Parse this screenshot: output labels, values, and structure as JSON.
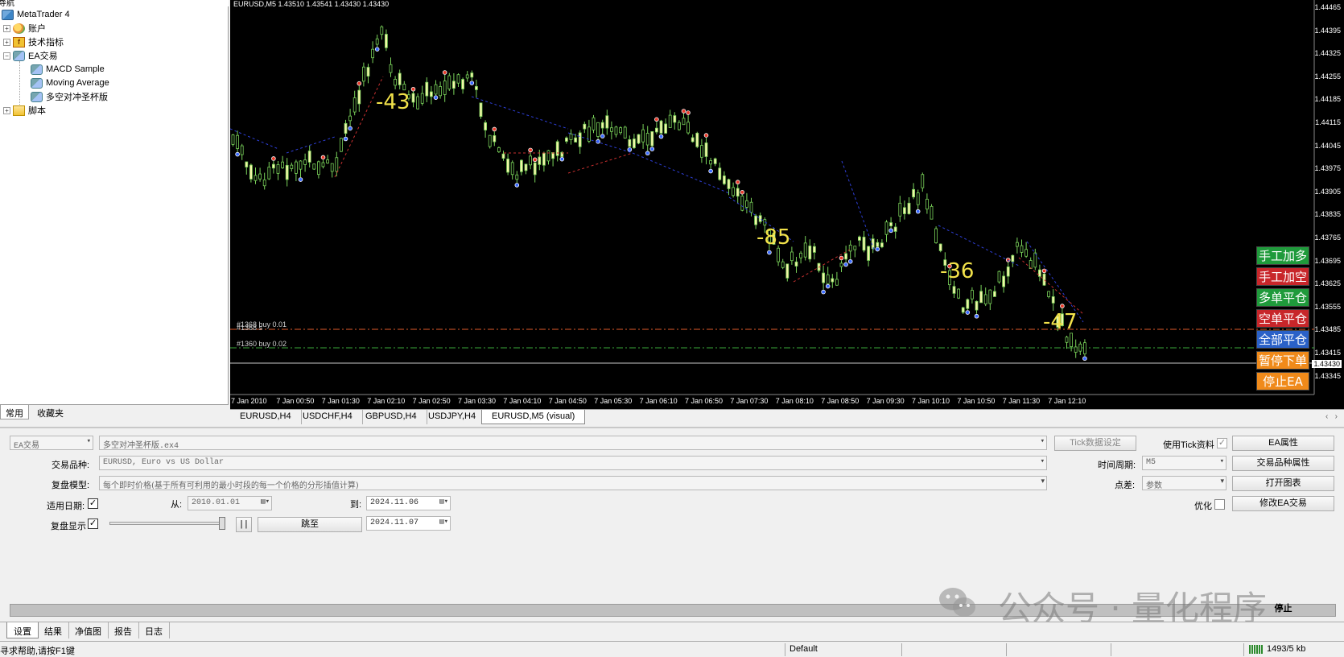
{
  "navigator": {
    "title": "导航",
    "tree": {
      "root": "MetaTrader 4",
      "accounts": "账户",
      "indicators": "技术指标",
      "experts": "EA交易",
      "expert_items": [
        "MACD Sample",
        "Moving Average",
        "多空对冲圣杯版"
      ],
      "scripts": "脚本"
    },
    "tabs": [
      "常用",
      "收藏夹"
    ]
  },
  "chart": {
    "header": "EURUSD,M5  1.43510 1.43541 1.43430 1.43430",
    "trade_labels": [
      "#1368 s",
      "#1368 buy 0.01",
      "#1360 buy 0.02"
    ],
    "profit_labels": [
      "-43",
      "-85",
      "-36",
      "-47"
    ],
    "price_ticks": [
      "1.44465",
      "1.44395",
      "1.44325",
      "1.44255",
      "1.44185",
      "1.44115",
      "1.44045",
      "1.43975",
      "1.43905",
      "1.43835",
      "1.43765",
      "1.43695",
      "1.43625",
      "1.43555",
      "1.43485",
      "1.43415",
      "1.43345"
    ],
    "current_price": "1.43430",
    "time_ticks": [
      "7 Jan 2010",
      "7 Jan 00:50",
      "7 Jan 01:30",
      "7 Jan 02:10",
      "7 Jan 02:50",
      "7 Jan 03:30",
      "7 Jan 04:10",
      "7 Jan 04:50",
      "7 Jan 05:30",
      "7 Jan 06:10",
      "7 Jan 06:50",
      "7 Jan 07:30",
      "7 Jan 08:10",
      "7 Jan 08:50",
      "7 Jan 09:30",
      "7 Jan 10:10",
      "7 Jan 10:50",
      "7 Jan 11:30",
      "7 Jan 12:10"
    ],
    "ea_buttons": [
      {
        "label": "手工加多",
        "color": "#1f9a3b"
      },
      {
        "label": "手工加空",
        "color": "#c8262a"
      },
      {
        "label": "多单平仓",
        "color": "#1f9a3b"
      },
      {
        "label": "空单平仓",
        "color": "#c8262a"
      },
      {
        "label": "全部平仓",
        "color": "#2a61c8"
      },
      {
        "label": "暂停下单",
        "color": "#f08a1a"
      },
      {
        "label": "停止EA",
        "color": "#f08a1a"
      }
    ],
    "tabs": [
      "EURUSD,H4",
      "USDCHF,H4",
      "GBPUSD,H4",
      "USDJPY,H4",
      "EURUSD,M5 (visual)"
    ],
    "active_tab": "EURUSD,M5 (visual)",
    "colors": {
      "bull": "#f4f4a8",
      "bear": "#1a8a2a",
      "wick": "#7ad35a",
      "buy_marker": "#3a6aff",
      "sell_marker": "#e83a2a"
    }
  },
  "tester": {
    "type_select": "EA交易",
    "ea_file": "多空对冲圣杯版.ex4",
    "tick_settings_btn": "Tick数据设定",
    "use_tick_label": "使用Tick资料",
    "ea_props_btn": "EA属性",
    "symbol_label": "交易品种:",
    "symbol_value": "EURUSD, Euro vs US Dollar",
    "period_label": "时间周期:",
    "period_value": "M5",
    "symbol_props_btn": "交易品种属性",
    "model_label": "复盘模型:",
    "model_value": "每个即时价格(基于所有可利用的最小时段的每一个价格的分形插值计算)",
    "spread_label": "点差:",
    "spread_value": "参数",
    "open_chart_btn": "打开图表",
    "use_date_label": "适用日期:",
    "from_label": "从:",
    "from_value": "2010.01.01",
    "to_label": "到:",
    "to_value": "2024.11.06",
    "optimize_label": "优化",
    "modify_ea_btn": "修改EA交易",
    "visual_label": "复盘显示",
    "pause_btn": "| |",
    "skip_to_btn": "跳至",
    "skip_date": "2024.11.07",
    "stop_btn": "停止",
    "watermark": "公众号 · 量化程序",
    "tabs": [
      "设置",
      "结果",
      "净值图",
      "报告",
      "日志"
    ],
    "active_tab": "设置"
  },
  "status_bar": {
    "help": "寻求帮助,请按F1键",
    "profile": "Default",
    "traffic": "1493/5 kb"
  }
}
